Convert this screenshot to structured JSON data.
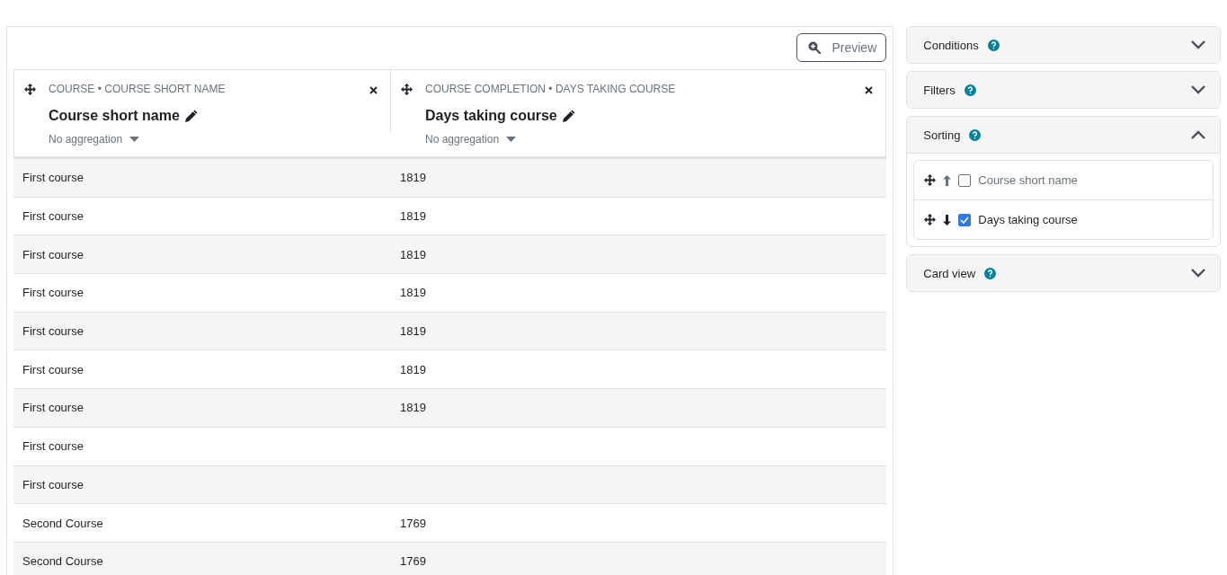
{
  "preview_button": "Preview",
  "columns": [
    {
      "source": "COURSE • COURSE SHORT NAME",
      "title": "Course short name",
      "aggregation": "No aggregation"
    },
    {
      "source": "COURSE COMPLETION • DAYS TAKING COURSE",
      "title": "Days taking course",
      "aggregation": "No aggregation"
    }
  ],
  "rows": [
    [
      "First course",
      "1819"
    ],
    [
      "First course",
      "1819"
    ],
    [
      "First course",
      "1819"
    ],
    [
      "First course",
      "1819"
    ],
    [
      "First course",
      "1819"
    ],
    [
      "First course",
      "1819"
    ],
    [
      "First course",
      "1819"
    ],
    [
      "First course",
      ""
    ],
    [
      "First course",
      ""
    ],
    [
      "Second Course",
      "1769"
    ],
    [
      "Second Course",
      "1769"
    ]
  ],
  "sections": [
    {
      "title": "Conditions",
      "expanded": false
    },
    {
      "title": "Filters",
      "expanded": false
    },
    {
      "title": "Sorting",
      "expanded": true,
      "items": [
        {
          "label": "Course short name",
          "descending": false,
          "checked": false
        },
        {
          "label": "Days taking course",
          "descending": true,
          "checked": true
        }
      ]
    },
    {
      "title": "Card view",
      "expanded": false
    }
  ]
}
